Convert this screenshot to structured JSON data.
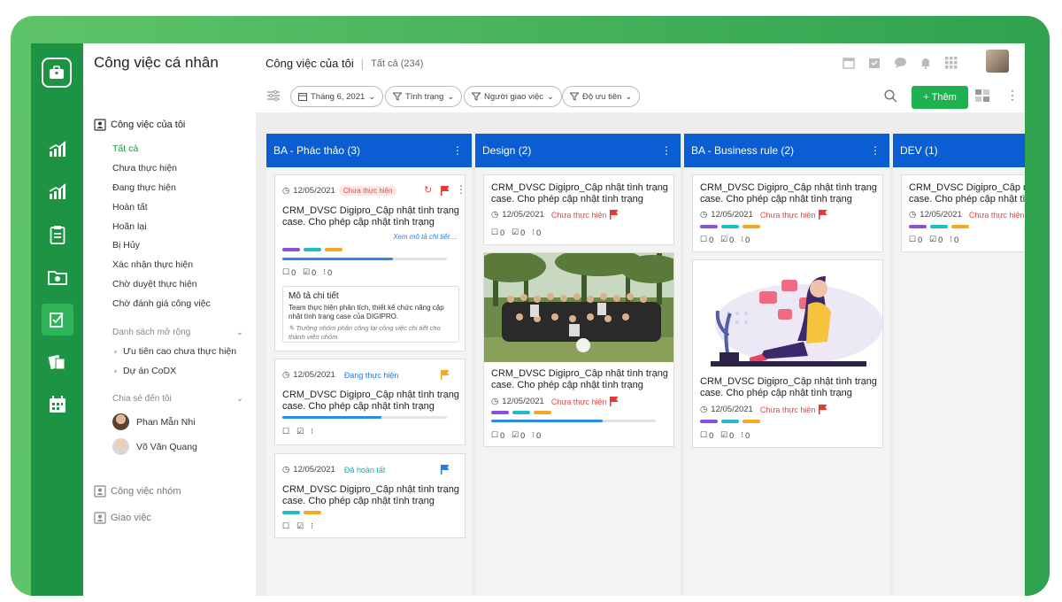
{
  "sidebar": {
    "title": "Công việc cá nhân",
    "my_tasks": "Công việc của tôi",
    "items": [
      {
        "label": "Tất cả",
        "active": true
      },
      {
        "label": "Chưa thực hiện"
      },
      {
        "label": "Đang thực hiện"
      },
      {
        "label": "Hoàn tất"
      },
      {
        "label": "Hoãn lại"
      },
      {
        "label": "Bị Hủy"
      },
      {
        "label": "Xác nhận thực hiện"
      },
      {
        "label": "Chờ duyệt thực hiện"
      },
      {
        "label": "Chờ đánh giá công việc"
      }
    ],
    "extended_list": "Danh sách mở rộng",
    "extended_items": [
      "Ưu tiên cao chưa thực hiện",
      "Dự án CoDX"
    ],
    "shared_to_me": "Chia sẻ đến tôi",
    "people": [
      "Phan Mẫn Nhi",
      "Võ Văn Quang"
    ],
    "group_tasks": "Công việc nhóm",
    "assign": "Giao việc"
  },
  "header": {
    "title": "Công việc của tôi",
    "subtitle": "Tất cả (234)",
    "add_label": "Thêm"
  },
  "filters": [
    "Tháng 6, 2021",
    "Tình trạng",
    "Người giao việc",
    "Độ ưu tiên"
  ],
  "columns": [
    {
      "title": "BA - Phác thảo (3)"
    },
    {
      "title": "Design (2)"
    },
    {
      "title": "BA - Business rule (2)"
    },
    {
      "title": "DEV (1)"
    }
  ],
  "cards": {
    "task_text": "CRM_DVSC Digipro_Cập nhật tình trạng case. Cho phép cập nhật tình trạng",
    "date": "12/05/2021",
    "status_not_started": "Chưa thực hiện",
    "status_in_progress": "Đang thực hiện",
    "status_done": "Đã hoàn tất",
    "zero": "0",
    "see_detail": "Xem mô tả chi tiết ...",
    "desc_title": "Mô tả chi tiết",
    "desc_body": "Team thực hiện phân tích, thiết kế chức năng cập nhật tình trạng case của DIGIPRO.",
    "desc_note": "Trưởng nhóm phân công lại công việc chi tiết cho thành viên nhóm"
  },
  "colors": {
    "green": "#1d9443",
    "blue": "#0a5ed1",
    "purple": "#8a4fe0",
    "teal": "#20bcc4",
    "orange": "#f5a623",
    "flag_red": "#e53935",
    "flag_yellow": "#f5a623",
    "flag_blue": "#2b7be0"
  }
}
